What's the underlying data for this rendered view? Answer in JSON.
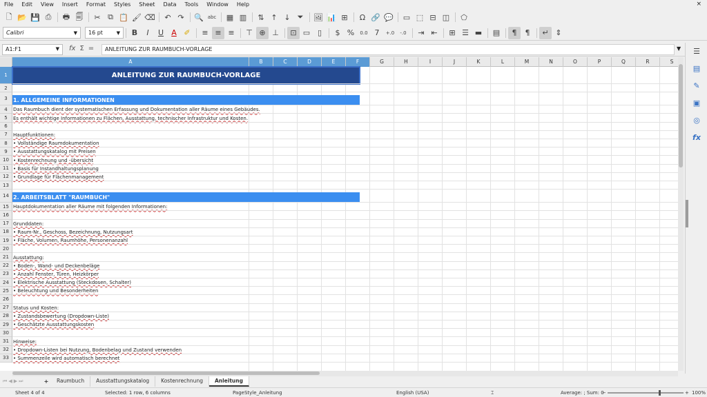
{
  "menu": [
    "File",
    "Edit",
    "View",
    "Insert",
    "Format",
    "Styles",
    "Sheet",
    "Data",
    "Tools",
    "Window",
    "Help"
  ],
  "close_symbol": "×",
  "toolbar1_icons": [
    "new-document-icon",
    "open-folder-icon",
    "save-icon",
    "export-pdf-icon",
    "print-icon",
    "print-preview-icon",
    "cut-icon",
    "copy-icon",
    "paste-icon",
    "clone-formatting-icon",
    "clear-formatting-icon",
    "undo-icon",
    "redo-icon",
    "find-replace-icon",
    "spelling-icon",
    "row-icon",
    "column-icon",
    "sort-icon",
    "sort-ascending-icon",
    "sort-descending-icon",
    "autofilter-icon",
    "image-icon",
    "chart-icon",
    "pivot-table-icon",
    "special-character-icon",
    "hyperlink-icon",
    "comment-icon",
    "headers-footers-icon",
    "define-print-area-icon",
    "freeze-rows-columns-icon",
    "split-window-icon",
    "show-draw-functions-icon"
  ],
  "font": {
    "name": "Calibri",
    "size": "16 pt"
  },
  "toolbar2_icons": [
    "bold-icon",
    "italic-icon",
    "underline-icon",
    "font-color-icon",
    "highlight-color-icon",
    "align-left-icon",
    "align-center-icon",
    "align-right-icon",
    "align-top-icon",
    "align-middle-icon",
    "align-bottom-icon",
    "merge-center-icon",
    "merge-cells-icon",
    "unmerge-cells-icon",
    "number-format-icon",
    "percent-format-icon",
    "decimal-format-icon",
    "date-format-icon",
    "add-decimal-icon",
    "delete-decimal-icon",
    "increase-indent-icon",
    "decrease-indent-icon",
    "borders-icon",
    "border-style-icon",
    "border-color-icon",
    "conditional-icon",
    "text-direction-ltr-icon",
    "text-direction-rtl-icon",
    "wrap-text-icon",
    "vertical-text-icon"
  ],
  "formula": {
    "cell_ref": "A1:F1",
    "fx": "fx",
    "sum": "Σ",
    "equals": "=",
    "content": "ANLEITUNG ZUR RAUMBUCH-VORLAGE"
  },
  "columns": [
    "A",
    "B",
    "C",
    "D",
    "E",
    "F",
    "G",
    "H",
    "I",
    "J",
    "K",
    "L",
    "M",
    "N",
    "O",
    "P",
    "Q",
    "R",
    "S"
  ],
  "rows": [
    {
      "n": "1",
      "text": "ANLEITUNG ZUR RAUMBUCH-VORLAGE",
      "style": "title"
    },
    {
      "n": "2",
      "text": ""
    },
    {
      "n": "3",
      "text": "1. ALLGEMEINE INFORMATIONEN",
      "style": "banner"
    },
    {
      "n": "4",
      "text": "Das Raumbuch dient der systematischen Erfassung und Dokumentation aller Räume eines Gebäudes."
    },
    {
      "n": "5",
      "text": "Es enthält wichtige Informationen zu Flächen, Ausstattung, technischer Infrastruktur und Kosten."
    },
    {
      "n": "6",
      "text": ""
    },
    {
      "n": "7",
      "text": "Hauptfunktionen:"
    },
    {
      "n": "8",
      "text": "• Vollständige Raumdokumentation"
    },
    {
      "n": "9",
      "text": "• Ausstattungskatalog mit Preisen"
    },
    {
      "n": "10",
      "text": "• Kostenrechnung und -übersicht"
    },
    {
      "n": "11",
      "text": "• Basis für Instandhaltungsplanung"
    },
    {
      "n": "12",
      "text": "• Grundlage für Flächenmanagement"
    },
    {
      "n": "13",
      "text": ""
    },
    {
      "n": "14",
      "text": "2. ARBEITSBLATT \"RAUMBUCH\"",
      "style": "banner"
    },
    {
      "n": "15",
      "text": "Hauptdokumentation aller Räume mit folgenden Informationen:"
    },
    {
      "n": "16",
      "text": ""
    },
    {
      "n": "17",
      "text": "Grunddaten:"
    },
    {
      "n": "18",
      "text": "• Raum-Nr., Geschoss, Bezeichnung, Nutzungsart"
    },
    {
      "n": "19",
      "text": "• Fläche, Volumen, Raumhöhe, Personenanzahl"
    },
    {
      "n": "20",
      "text": ""
    },
    {
      "n": "21",
      "text": "Ausstattung:"
    },
    {
      "n": "22",
      "text": "• Boden-, Wand- und Deckenbeläge"
    },
    {
      "n": "23",
      "text": "• Anzahl Fenster, Türen, Heizkörper"
    },
    {
      "n": "24",
      "text": "• Elektrische Ausstattung (Steckdosen, Schalter)"
    },
    {
      "n": "25",
      "text": "• Beleuchtung und Besonderheiten"
    },
    {
      "n": "26",
      "text": ""
    },
    {
      "n": "27",
      "text": "Status und Kosten:"
    },
    {
      "n": "28",
      "text": "• Zustandsbewertung (Dropdown-Liste)"
    },
    {
      "n": "29",
      "text": "• Geschätzte Ausstattungskosten"
    },
    {
      "n": "30",
      "text": ""
    },
    {
      "n": "31",
      "text": "Hinweise:"
    },
    {
      "n": "32",
      "text": "• Dropdown-Listen bei Nutzung, Bodenbelag und Zustand verwenden"
    },
    {
      "n": "33",
      "text": "• Summenzeile wird automatisch berechnet"
    }
  ],
  "sheet_tabs": [
    "Raumbuch",
    "Ausstattungskatalog",
    "Kostenrechnung",
    "Anleitung"
  ],
  "active_tab": "Anleitung",
  "add_tab": "+",
  "status": {
    "sheet": "Sheet 4 of 4",
    "selection": "Selected: 1 row, 6 columns",
    "page_style": "PageStyle_Anleitung",
    "language": "English (USA)",
    "summary": "Average: ; Sum: 0",
    "zoom": "100%"
  },
  "colors": {
    "title_bg": "#24498f",
    "banner_bg": "#3b8ef0",
    "selection": "#5b9bd5"
  }
}
